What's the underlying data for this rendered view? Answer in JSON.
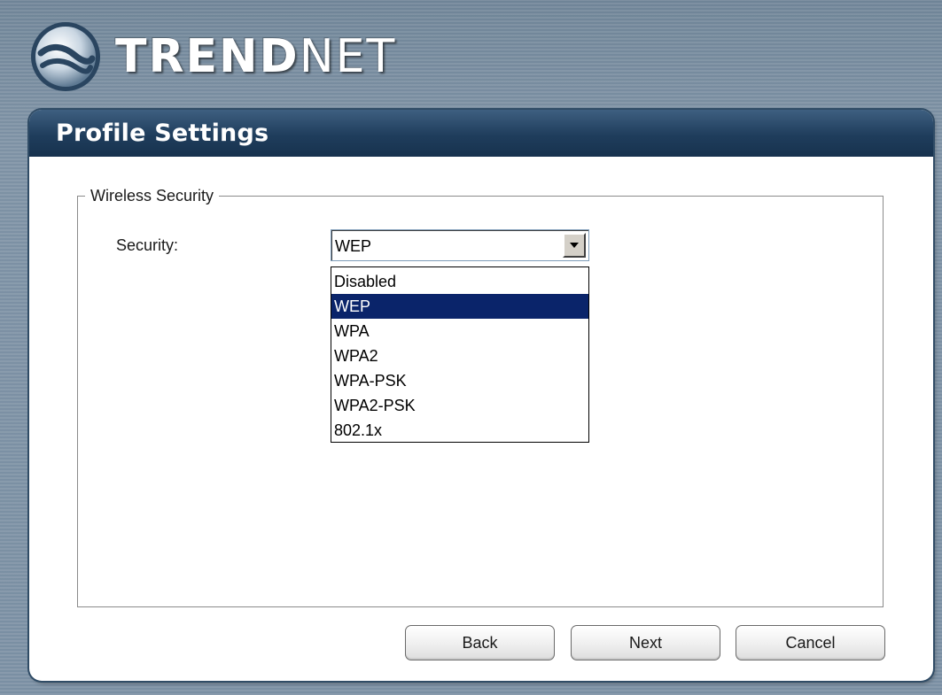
{
  "header": {
    "logo_text_bold": "TREND",
    "logo_text_light": "NET",
    "logo_icon": "trendnet-globe-icon"
  },
  "panel": {
    "title": "Profile Settings"
  },
  "wireless_security": {
    "group_label": "Wireless Security",
    "security_label": "Security:",
    "selected_value": "WEP",
    "dropdown_icon": "chevron-down-icon",
    "options": [
      "Disabled",
      "WEP",
      "WPA",
      "WPA2",
      "WPA-PSK",
      "WPA2-PSK",
      "802.1x"
    ],
    "highlighted_option": "WEP"
  },
  "buttons": {
    "back": "Back",
    "next": "Next",
    "cancel": "Cancel"
  },
  "colors": {
    "header_bar": "#1f3d5c",
    "selection_highlight": "#0a246a",
    "background": "#7a8fa3"
  }
}
